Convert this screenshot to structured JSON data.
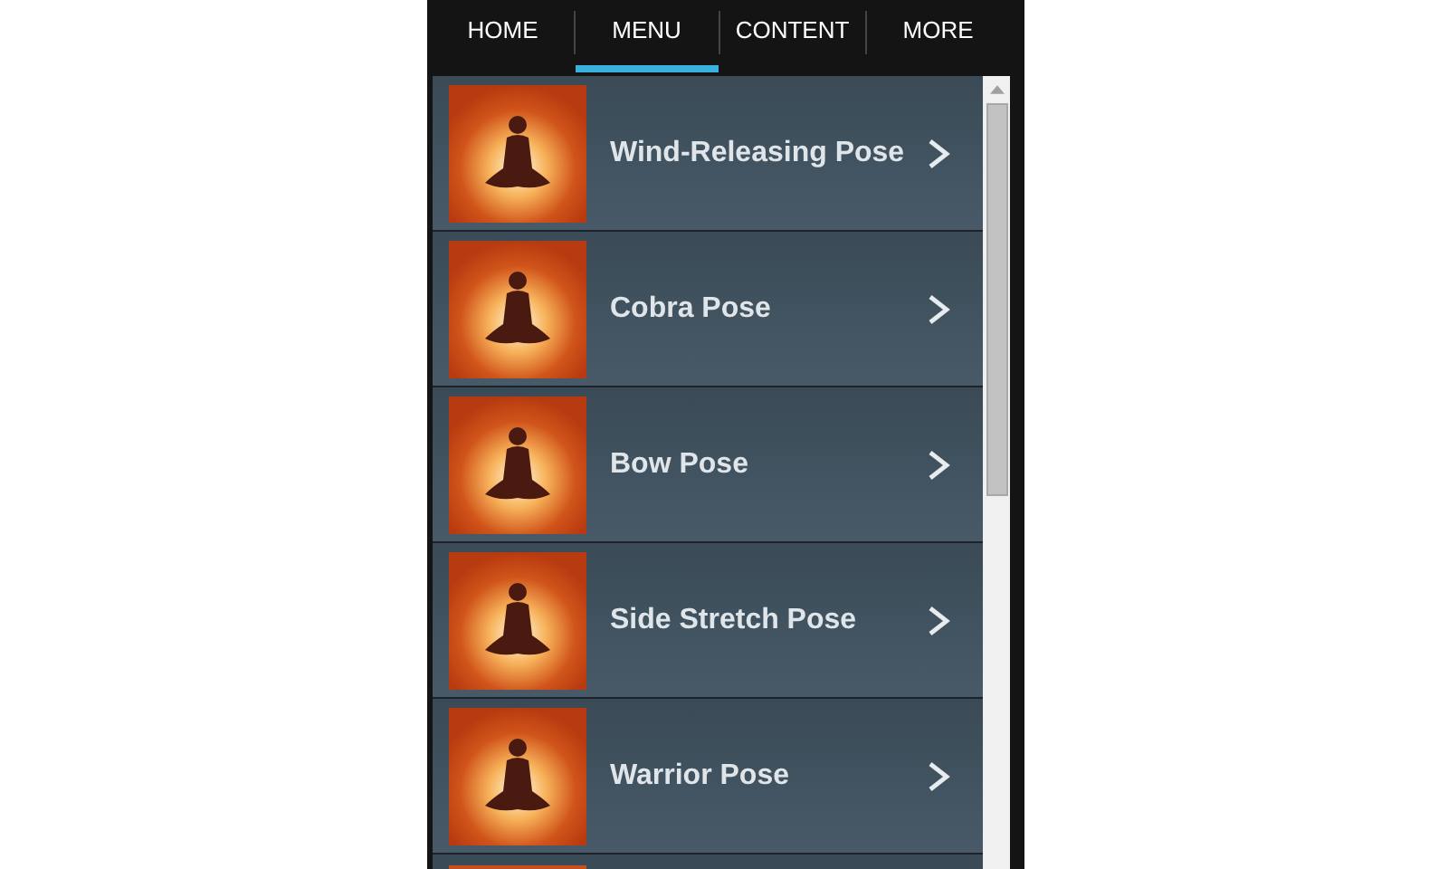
{
  "tabs": [
    {
      "label": "HOME",
      "selected": false
    },
    {
      "label": "MENU",
      "selected": true
    },
    {
      "label": "CONTENT",
      "selected": false
    },
    {
      "label": "MORE",
      "selected": false
    }
  ],
  "list": {
    "items": [
      {
        "title": "Wind-Releasing Pose"
      },
      {
        "title": "Cobra Pose"
      },
      {
        "title": "Bow Pose"
      },
      {
        "title": "Side Stretch Pose"
      },
      {
        "title": "Warrior Pose"
      }
    ],
    "more_below": true
  }
}
